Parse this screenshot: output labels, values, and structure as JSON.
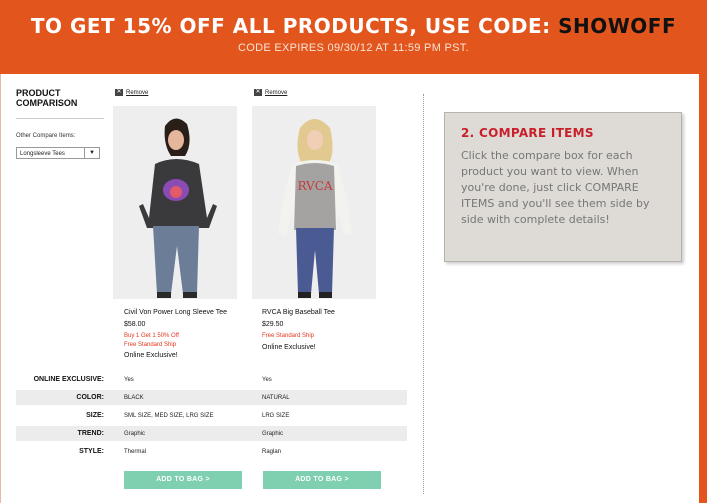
{
  "banner": {
    "main_prefix": "TO GET 15% OFF ALL PRODUCTS, USE CODE:",
    "code": "SHOWOFF",
    "sub": "CODE EXPIRES 09/30/12 AT 11:59 PM PST."
  },
  "sidebar": {
    "title": "PRODUCT COMPARISON",
    "other_label": "Other Compare Items:",
    "select_value": "Longsleeve Tees"
  },
  "remove_label": "Remove",
  "products": [
    {
      "name": "Civil Von Power Long Sleeve Tee",
      "price": "$58.00",
      "promo1": "Buy 1 Get 1 50% Off",
      "promo2": "Free Standard Ship",
      "exclusive": "Online Exclusive!",
      "button": "ADD TO BAG >",
      "attrs": [
        "Yes",
        "BLACK",
        "SML SIZE, MED SIZE, LRG SIZE",
        "Graphic",
        "Thermal"
      ]
    },
    {
      "name": "RVCA Big Baseball Tee",
      "price": "$29.50",
      "promo1": "Free Standard Ship",
      "exclusive": "Online Exclusive!",
      "button": "ADD TO BAG >",
      "logo_text": "RVCA",
      "attrs": [
        "Yes",
        "NATURAL",
        "LRG SIZE",
        "Graphic",
        "Raglan"
      ]
    }
  ],
  "attribute_labels": [
    "ONLINE EXCLUSIVE:",
    "COLOR:",
    "SIZE:",
    "TREND:",
    "STYLE:"
  ],
  "instructions": {
    "title": "2. COMPARE ITEMS",
    "body": "Click the compare box for each product you want to view. When you're done, just click COMPARE ITEMS and you'll see them side by side with complete details!"
  },
  "colors": {
    "banner": "#e2561d",
    "button": "#7fcfb1",
    "promo": "#e2361d",
    "card_title": "#c8202a"
  }
}
